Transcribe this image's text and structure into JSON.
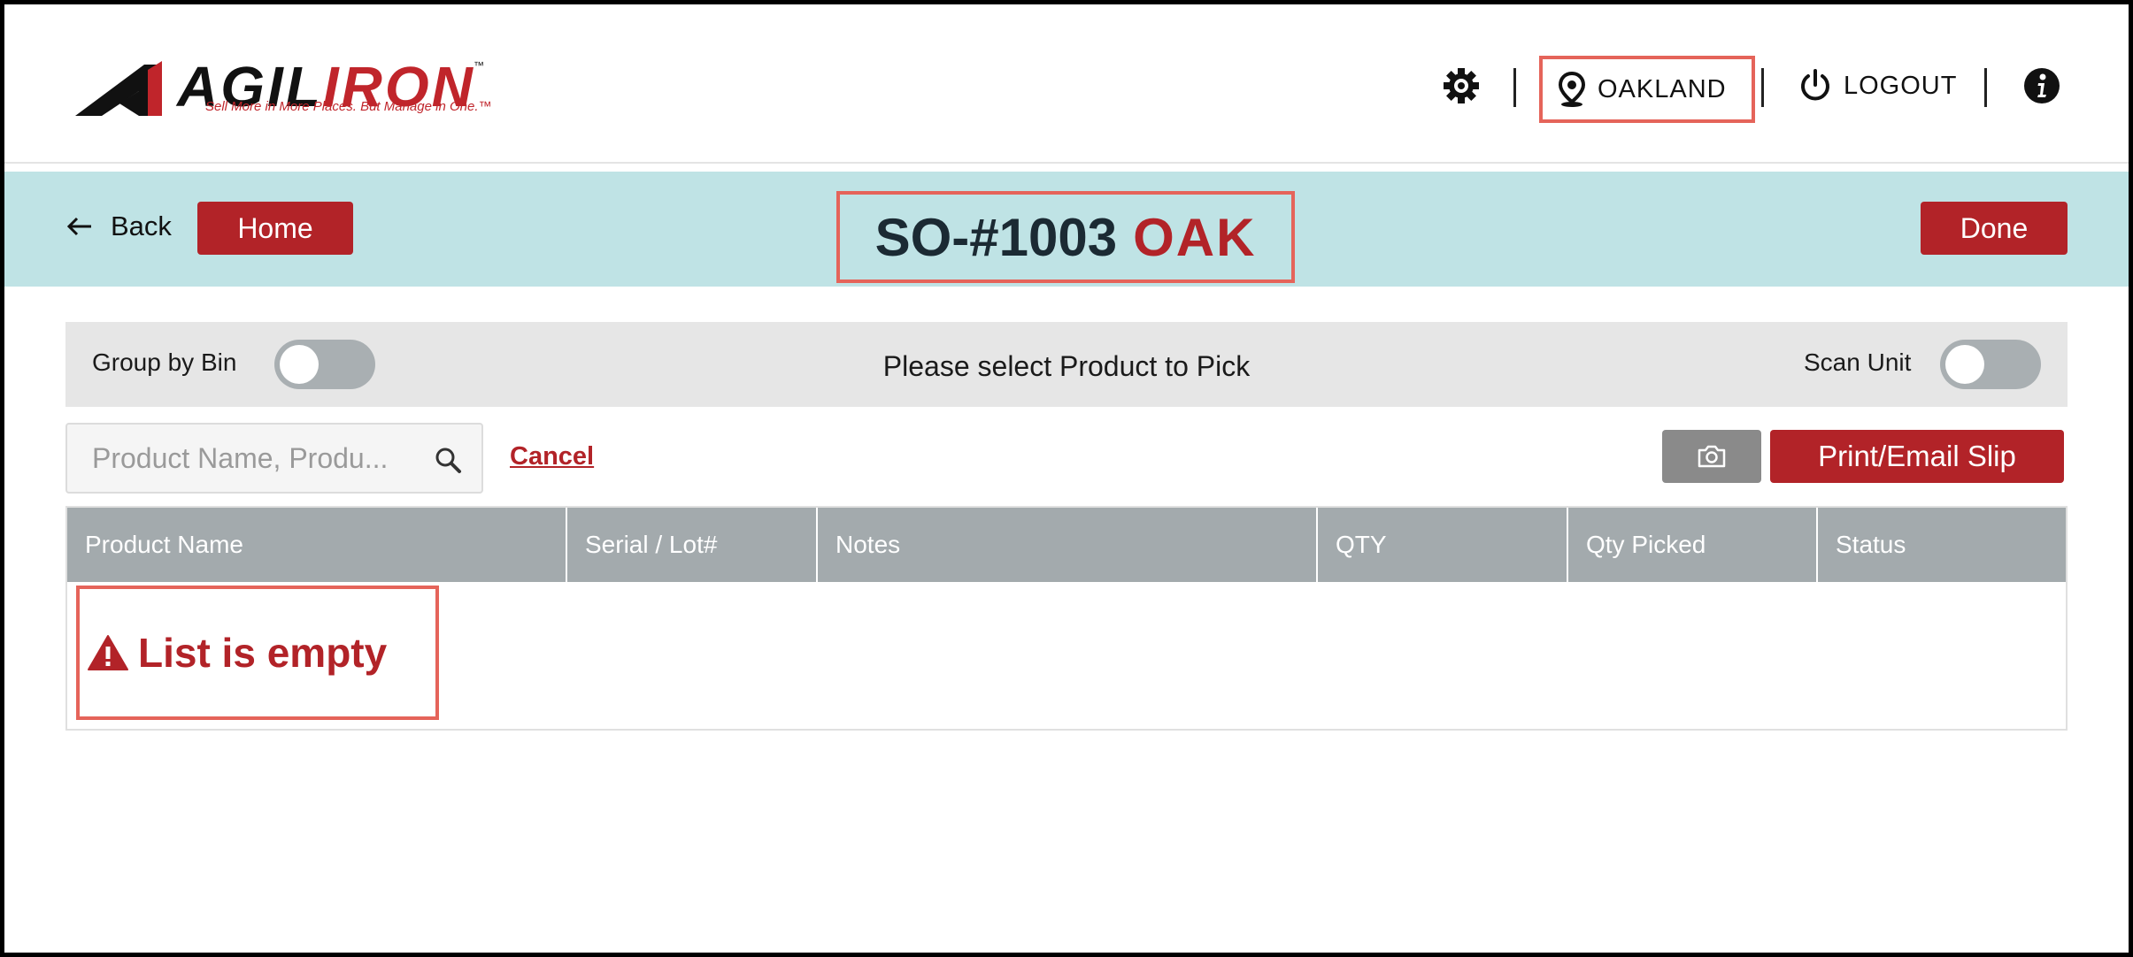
{
  "header": {
    "logo_word_black": "AGIL",
    "logo_word_red": "IRON",
    "logo_tm": "™",
    "logo_tagline": "Sell More in More Places. But Manage in One.™",
    "location": "OAKLAND",
    "logout_label": "LOGOUT",
    "icons": [
      "gear-icon",
      "location-pin-icon",
      "power-icon",
      "info-icon"
    ]
  },
  "titlebar": {
    "back_label": "Back",
    "home_label": "Home",
    "order_number": "SO-#1003",
    "location_code": "OAK",
    "done_label": "Done"
  },
  "options": {
    "group_by_bin_label": "Group by Bin",
    "group_by_bin_on": false,
    "instruction": "Please select Product to Pick",
    "scan_unit_label": "Scan Unit",
    "scan_unit_on": false
  },
  "search": {
    "placeholder": "Product Name, Produ...",
    "value": "",
    "cancel_label": "Cancel"
  },
  "actions": {
    "print_label": "Print/Email Slip"
  },
  "table": {
    "columns": [
      "Product Name",
      "Serial / Lot#",
      "Notes",
      "QTY",
      "Qty Picked",
      "Status"
    ],
    "rows": [],
    "empty_message": "List is empty"
  },
  "colors": {
    "brand_red": "#b22328",
    "highlight": "#e5645a",
    "titlebar_bg": "#bfe3e5",
    "table_header_bg": "#a3aaad"
  }
}
